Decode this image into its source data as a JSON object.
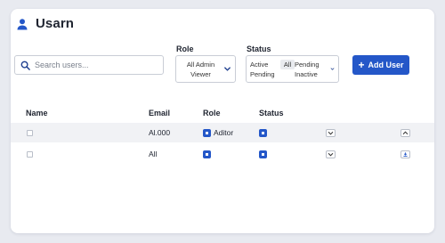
{
  "header": {
    "title": "Usarn",
    "icon": "user-icon"
  },
  "search": {
    "placeholder": "Search users..."
  },
  "filters": {
    "role_label": "Role",
    "role_options": [
      "All Admin",
      "Viewer"
    ],
    "status_label": "Status",
    "status_options": [
      "Active",
      "All",
      "Pending",
      "Pending",
      "Inactive"
    ]
  },
  "actions": {
    "add_user_label": "Add User"
  },
  "table": {
    "columns": [
      "Name",
      "Email",
      "Role",
      "Status"
    ],
    "rows": [
      {
        "name": "",
        "email": "Al.000",
        "role": "Aditor"
      },
      {
        "name": "",
        "email": "All",
        "role": ""
      }
    ]
  },
  "colors": {
    "accent": "#2457c8",
    "row_alt": "#f1f2f5",
    "background": "#e8eaf0"
  }
}
